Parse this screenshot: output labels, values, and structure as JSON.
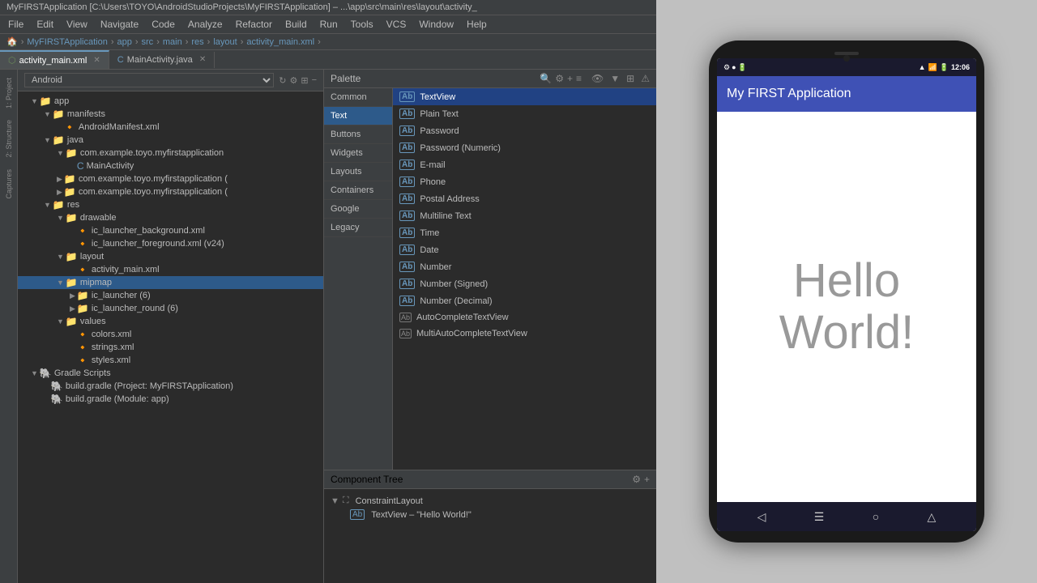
{
  "titlebar": {
    "text": "MyFIRSTApplication [C:\\Users\\TOYO\\AndroidStudioProjects\\MyFIRSTApplication] – ...\\app\\src\\main\\res\\layout\\activity_"
  },
  "menubar": {
    "items": [
      "File",
      "Edit",
      "View",
      "Navigate",
      "Code",
      "Analyze",
      "Refactor",
      "Build",
      "Run",
      "Tools",
      "VCS",
      "Window",
      "Help"
    ]
  },
  "navbar": {
    "items": [
      "MyFIRSTApplication",
      "app",
      "src",
      "main",
      "res",
      "layout",
      "activity_main.xml"
    ]
  },
  "tabs": [
    {
      "label": "activity_main.xml",
      "active": true,
      "icon": "xml"
    },
    {
      "label": "MainActivity.java",
      "active": false,
      "icon": "java"
    }
  ],
  "filetree": {
    "dropdown": "Android",
    "items": [
      {
        "indent": 1,
        "expanded": true,
        "type": "folder",
        "label": "app",
        "selected": false
      },
      {
        "indent": 2,
        "expanded": true,
        "type": "folder",
        "label": "manifests",
        "selected": false
      },
      {
        "indent": 3,
        "expanded": false,
        "type": "xml-file",
        "label": "AndroidManifest.xml",
        "selected": false
      },
      {
        "indent": 2,
        "expanded": true,
        "type": "folder",
        "label": "java",
        "selected": false
      },
      {
        "indent": 3,
        "expanded": true,
        "type": "folder",
        "label": "com.example.toyo.myfirstapplication",
        "selected": false
      },
      {
        "indent": 4,
        "expanded": false,
        "type": "java-file",
        "label": "MainActivity",
        "selected": false
      },
      {
        "indent": 3,
        "expanded": false,
        "type": "folder",
        "label": "com.example.toyo.myfirstapplication (",
        "selected": false
      },
      {
        "indent": 3,
        "expanded": false,
        "type": "folder",
        "label": "com.example.toyo.myfirstapplication (",
        "selected": false
      },
      {
        "indent": 2,
        "expanded": true,
        "type": "folder",
        "label": "res",
        "selected": false
      },
      {
        "indent": 3,
        "expanded": true,
        "type": "folder",
        "label": "drawable",
        "selected": false
      },
      {
        "indent": 4,
        "expanded": false,
        "type": "xml-file",
        "label": "ic_launcher_background.xml",
        "selected": false
      },
      {
        "indent": 4,
        "expanded": false,
        "type": "xml-file",
        "label": "ic_launcher_foreground.xml (v24)",
        "selected": false
      },
      {
        "indent": 3,
        "expanded": true,
        "type": "folder",
        "label": "layout",
        "selected": false
      },
      {
        "indent": 4,
        "expanded": false,
        "type": "xml-file",
        "label": "activity_main.xml",
        "selected": false
      },
      {
        "indent": 3,
        "expanded": true,
        "type": "folder",
        "label": "mipmap",
        "selected": true
      },
      {
        "indent": 4,
        "expanded": false,
        "type": "folder",
        "label": "ic_launcher (6)",
        "selected": false
      },
      {
        "indent": 4,
        "expanded": false,
        "type": "folder",
        "label": "ic_launcher_round (6)",
        "selected": false
      },
      {
        "indent": 3,
        "expanded": true,
        "type": "folder",
        "label": "values",
        "selected": false
      },
      {
        "indent": 4,
        "expanded": false,
        "type": "xml-file",
        "label": "colors.xml",
        "selected": false
      },
      {
        "indent": 4,
        "expanded": false,
        "type": "xml-file",
        "label": "strings.xml",
        "selected": false
      },
      {
        "indent": 4,
        "expanded": false,
        "type": "xml-file",
        "label": "styles.xml",
        "selected": false
      },
      {
        "indent": 1,
        "expanded": true,
        "type": "folder",
        "label": "Gradle Scripts",
        "selected": false
      },
      {
        "indent": 2,
        "expanded": false,
        "type": "gradle-file",
        "label": "build.gradle (Project: MyFIRSTApplication)",
        "selected": false
      },
      {
        "indent": 2,
        "expanded": false,
        "type": "gradle-file",
        "label": "build.gradle (Module: app)",
        "selected": false
      }
    ]
  },
  "palette": {
    "title": "Palette",
    "categories": [
      "Common",
      "Text",
      "Buttons",
      "Widgets",
      "Layouts",
      "Containers",
      "Google",
      "Legacy"
    ],
    "active_category": "Text",
    "items": [
      {
        "label": "TextView",
        "active": true
      },
      {
        "label": "Plain Text",
        "active": false
      },
      {
        "label": "Password",
        "active": false
      },
      {
        "label": "Password (Numeric)",
        "active": false
      },
      {
        "label": "E-mail",
        "active": false
      },
      {
        "label": "Phone",
        "active": false
      },
      {
        "label": "Postal Address",
        "active": false
      },
      {
        "label": "Multiline Text",
        "active": false
      },
      {
        "label": "Time",
        "active": false
      },
      {
        "label": "Date",
        "active": false
      },
      {
        "label": "Number",
        "active": false
      },
      {
        "label": "Number (Signed)",
        "active": false
      },
      {
        "label": "Number (Decimal)",
        "active": false
      },
      {
        "label": "AutoCompleteTextView",
        "active": false
      },
      {
        "label": "MultiAutoCompleteTextView",
        "active": false
      }
    ]
  },
  "component_tree": {
    "title": "Component Tree",
    "items": [
      {
        "indent": 0,
        "label": "ConstraintLayout",
        "icon": "layout"
      },
      {
        "indent": 1,
        "label": "Ab TextView – \"Hello World!\"",
        "icon": "textview"
      }
    ]
  },
  "phone": {
    "status_bar": {
      "time": "12:06",
      "icons": [
        "settings",
        "wifi",
        "signal",
        "battery"
      ]
    },
    "action_bar": {
      "title": "My FIRST Application"
    },
    "content": {
      "text": "Hello World!"
    }
  },
  "sidebar_tabs": [
    "Project",
    "Structure",
    "Captures"
  ]
}
